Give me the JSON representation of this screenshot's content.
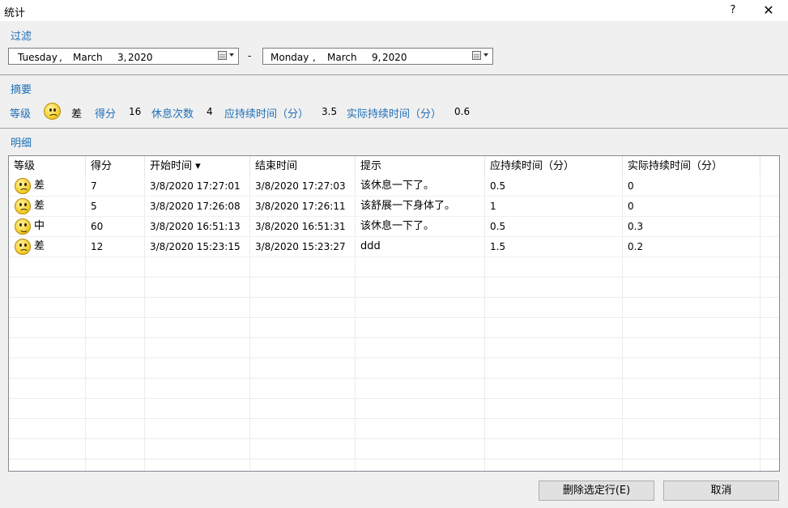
{
  "window": {
    "title": "统计",
    "help": "?",
    "close": "✕"
  },
  "filter": {
    "label": "过滤",
    "from": {
      "weekday": "Tuesday",
      "comma": ",",
      "month": "March",
      "day": "3,",
      "year": "2020"
    },
    "dash": "-",
    "to": {
      "weekday": "Monday",
      "comma": ",",
      "month": "March",
      "day": "9,",
      "year": "2020"
    }
  },
  "summary": {
    "label": "摘要",
    "grade_label": "等级",
    "grade_value": "差",
    "score_label": "得分",
    "score_value": "16",
    "breaks_label": "休息次数",
    "breaks_value": "4",
    "expected_label": "应持续时间（分）",
    "expected_value": "3.5",
    "actual_label": "实际持续时间（分）",
    "actual_value": "0.6"
  },
  "detail": {
    "label": "明细",
    "columns": [
      "等级",
      "得分",
      "开始时间 ▾",
      "结束时间",
      "提示",
      "应持续时间（分）",
      "实际持续时间（分）"
    ],
    "rows": [
      {
        "mood": "sad",
        "grade": "差",
        "score": "7",
        "start": "3/8/2020 17:27:01",
        "end": "3/8/2020 17:27:03",
        "tip": "该休息一下了。",
        "expected": "0.5",
        "actual": "0"
      },
      {
        "mood": "sad",
        "grade": "差",
        "score": "5",
        "start": "3/8/2020 17:26:08",
        "end": "3/8/2020 17:26:11",
        "tip": "该舒展一下身体了。",
        "expected": "1",
        "actual": "0"
      },
      {
        "mood": "happy",
        "grade": "中",
        "score": "60",
        "start": "3/8/2020 16:51:13",
        "end": "3/8/2020 16:51:31",
        "tip": "该休息一下了。",
        "expected": "0.5",
        "actual": "0.3"
      },
      {
        "mood": "sad",
        "grade": "差",
        "score": "12",
        "start": "3/8/2020 15:23:15",
        "end": "3/8/2020 15:23:27",
        "tip": "ddd",
        "expected": "1.5",
        "actual": "0.2"
      }
    ]
  },
  "buttons": {
    "delete": "删除选定行(E)",
    "cancel": "取消"
  },
  "colors": {
    "accent": "#1f6fb6",
    "face": "#f2c91c"
  }
}
